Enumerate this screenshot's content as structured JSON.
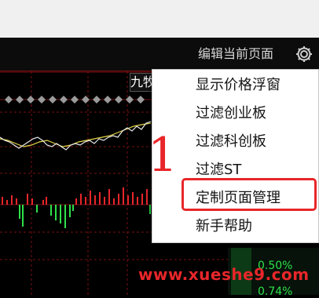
{
  "toolbar": {
    "edit_page_label": "编辑当前页面"
  },
  "stock_tab": {
    "label": "九牧"
  },
  "context_menu": {
    "items": [
      {
        "label": "显示价格浮窗"
      },
      {
        "label": "过滤创业板"
      },
      {
        "label": "过滤科创板"
      },
      {
        "label": "过滤ST"
      },
      {
        "label": "定制页面管理"
      },
      {
        "label": "新手帮助"
      }
    ],
    "highlighted_index": 4
  },
  "annotation": {
    "number": "1",
    "color": "#e8262a"
  },
  "percent_labels": [
    "0.50%",
    "0.74%"
  ],
  "watermark": {
    "text": "www.xueshe9.com"
  },
  "colors": {
    "rise": "#e8262a",
    "fall": "#2ee04a",
    "grid": "#7a1010",
    "background": "#000000"
  }
}
